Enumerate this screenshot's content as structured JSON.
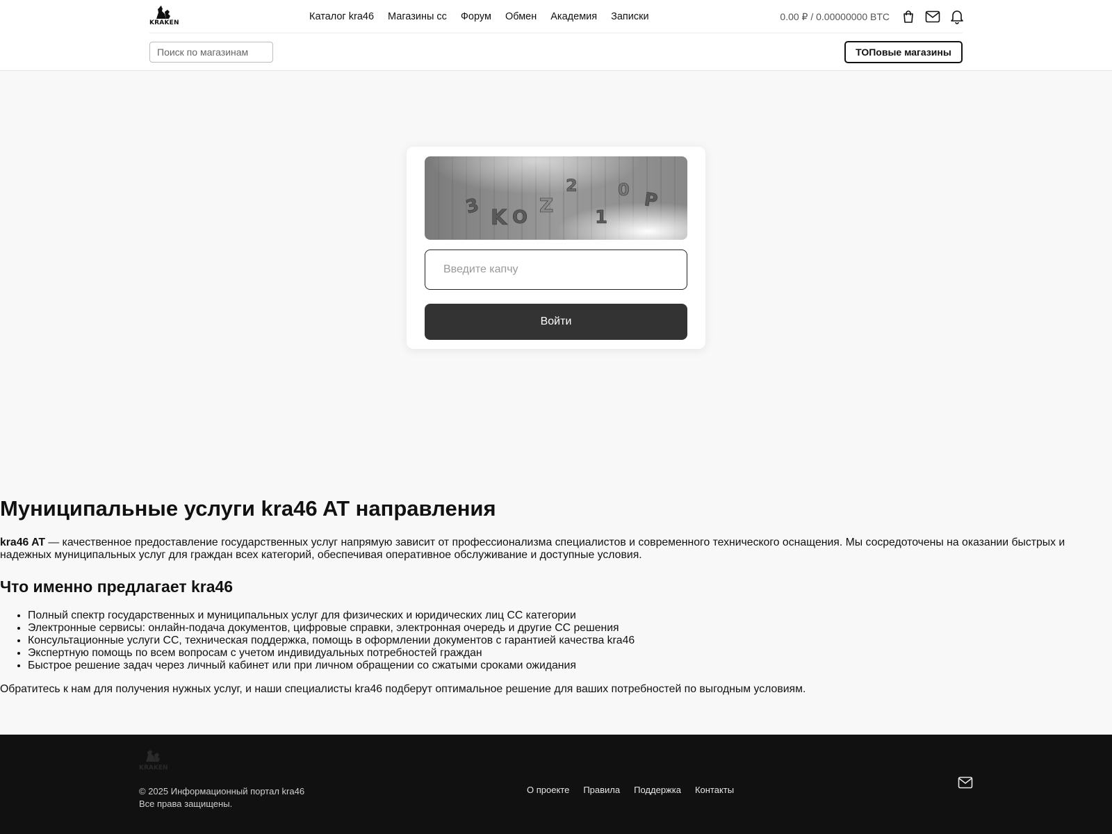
{
  "header": {
    "logo_text": "KRAKEN",
    "nav": [
      "Каталог kra46",
      "Магазины сс",
      "Форум",
      "Обмен",
      "Академия",
      "Записки"
    ],
    "balance": "0.00 ₽ / 0.00000000 BTC",
    "icons": [
      "bag-icon",
      "mail-icon",
      "bell-icon"
    ],
    "search_placeholder": "Поиск по магазинам",
    "top_button": "ТОПовые магазины"
  },
  "captcha": {
    "characters": [
      "3",
      "K",
      "O",
      "Z",
      "2",
      "1",
      "0",
      "P"
    ],
    "input_placeholder": "Введите капчу",
    "submit_label": "Войти"
  },
  "article": {
    "title": "Муниципальные услуги kra46 AT направления",
    "intro_bold": "kra46 AT",
    "intro_rest": " — качественное предоставление государственных услуг напрямую зависит от профессионализма специалистов и современного технического оснащения. Мы сосредоточены на оказании быстрых и надежных муниципальных услуг для граждан всех категорий, обеспечивая оперативное обслуживание и доступные условия.",
    "subtitle": "Что именно предлагает kra46",
    "list": [
      "Полный спектр государственных и муниципальных услуг для физических и юридических лиц СС категории",
      "Электронные сервисы: онлайн-подача документов, цифровые справки, электронная очередь и другие СС решения",
      "Консультационные услуги СС, техническая поддержка, помощь в оформлении документов с гарантией качества kra46",
      "Экспертную помощь по всем вопросам с учетом индивидуальных потребностей граждан",
      "Быстрое решение задач через личный кабинет или при личном обращении со сжатыми сроками ожидания"
    ],
    "outro": "Обратитесь к нам для получения нужных услуг, и наши специалисты kra46 подберут оптимальное решение для ваших потребностей по выгодным условиям."
  },
  "footer": {
    "logo_text": "KRAKEN",
    "copyright": "© 2025 Информационный портал kra46",
    "rights": "Все права защищены.",
    "links": [
      "О проекте",
      "Правила",
      "Поддержка",
      "Контакты"
    ]
  },
  "colors": {
    "page_bg": "#f8f8f8",
    "header_bg": "#ffffff",
    "button_dark": "#333333",
    "footer_bg": "#111111"
  }
}
